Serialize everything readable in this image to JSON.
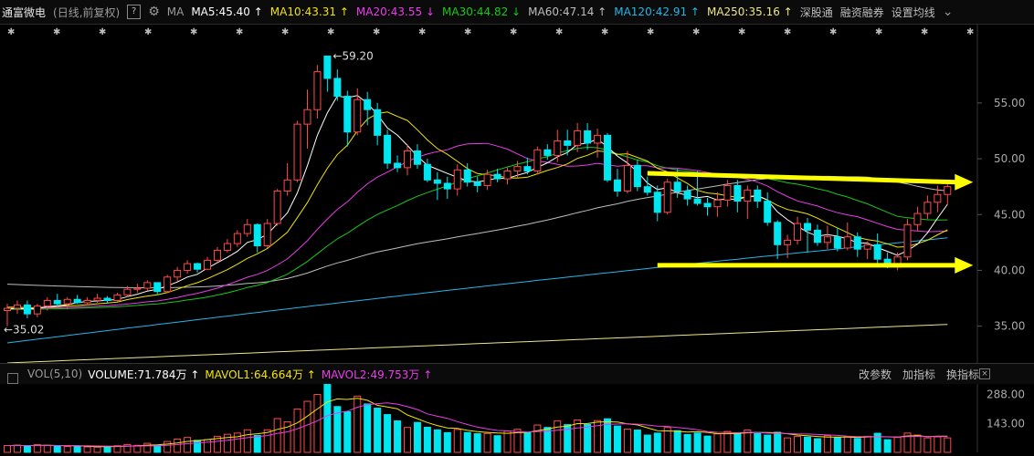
{
  "header": {
    "title": "通富微电",
    "subtitle": "(日线,前复权)",
    "help": "?",
    "ma_label": "MA",
    "ma_items": [
      {
        "text": "MA5:45.40 ↑",
        "color": "#ffffff"
      },
      {
        "text": "MA10:43.31 ↑",
        "color": "#f2e400"
      },
      {
        "text": "MA20:43.55 ↓",
        "color": "#e93de9"
      },
      {
        "text": "MA30:44.82 ↓",
        "color": "#18c818"
      },
      {
        "text": "MA60:47.14 ↑",
        "color": "#bdbdbd"
      },
      {
        "text": "MA120:42.91 ↑",
        "color": "#23b6e8"
      },
      {
        "text": "MA250:35.16 ↑",
        "color": "#efe58a"
      }
    ],
    "btn_shen": "深股通",
    "btn_rong": "融资融券",
    "btn_set": "设置均线"
  },
  "volume_header": {
    "label": "VOL(5,10)",
    "volume": "VOLUME:71.784万 ↑",
    "mavol1": "MAVOL1:64.664万 ↑",
    "mavol2": "MAVOL2:49.753万 ↑",
    "btn_params": "改参数",
    "btn_add": "加指标",
    "btn_switch": "换指标"
  },
  "colors": {
    "up": "#ff4a4a",
    "down": "#00e6f0",
    "annot": "#ffff00"
  },
  "chart_data": {
    "type": "candlestick",
    "price_axis": {
      "ticks": [
        35,
        40,
        45,
        50,
        55
      ],
      "ylim": [
        31.7,
        62.1
      ]
    },
    "volume_axis": {
      "ticks": [
        143,
        288
      ],
      "unit": "万",
      "ylim": [
        0,
        345
      ]
    },
    "annotations": {
      "high": "59.20",
      "low": "35.02"
    },
    "candles": [
      [
        36.4,
        37.0,
        35.0,
        36.6
      ],
      [
        36.6,
        37.3,
        36.1,
        36.9
      ],
      [
        36.9,
        37.3,
        35.7,
        36.1
      ],
      [
        36.1,
        37.0,
        35.8,
        36.8
      ],
      [
        36.8,
        37.6,
        36.4,
        37.3
      ],
      [
        37.3,
        37.9,
        36.8,
        37.0
      ],
      [
        37.0,
        37.6,
        36.5,
        37.4
      ],
      [
        37.4,
        37.8,
        37.0,
        37.1
      ],
      [
        37.1,
        37.6,
        36.9,
        37.3
      ],
      [
        37.3,
        37.9,
        37.1,
        37.5
      ],
      [
        37.5,
        37.7,
        37.0,
        37.3
      ],
      [
        37.3,
        38.0,
        37.2,
        37.8
      ],
      [
        37.8,
        38.6,
        37.6,
        38.3
      ],
      [
        38.3,
        38.8,
        38.0,
        38.4
      ],
      [
        38.4,
        39.1,
        38.2,
        38.9
      ],
      [
        38.9,
        38.9,
        37.8,
        38.1
      ],
      [
        38.1,
        39.6,
        38.0,
        39.4
      ],
      [
        39.4,
        40.3,
        39.0,
        40.0
      ],
      [
        40.0,
        40.9,
        39.7,
        40.6
      ],
      [
        40.6,
        40.7,
        39.8,
        40.1
      ],
      [
        40.1,
        41.2,
        40.0,
        40.9
      ],
      [
        40.9,
        42.1,
        40.6,
        41.8
      ],
      [
        41.8,
        42.8,
        41.6,
        42.4
      ],
      [
        42.4,
        43.6,
        42.1,
        43.3
      ],
      [
        43.3,
        44.6,
        43.0,
        44.1
      ],
      [
        44.1,
        44.2,
        41.6,
        42.2
      ],
      [
        42.2,
        44.6,
        42.0,
        44.2
      ],
      [
        44.2,
        47.3,
        44.0,
        47.1
      ],
      [
        47.1,
        49.6,
        46.7,
        48.1
      ],
      [
        48.1,
        53.4,
        47.9,
        53.1
      ],
      [
        53.1,
        56.2,
        50.9,
        54.4
      ],
      [
        54.4,
        58.4,
        53.6,
        57.8
      ],
      [
        59.2,
        59.2,
        56.0,
        57.2
      ],
      [
        57.2,
        58.0,
        55.2,
        55.6
      ],
      [
        55.6,
        56.1,
        51.1,
        52.4
      ],
      [
        52.4,
        56.3,
        52.1,
        55.3
      ],
      [
        55.3,
        56.0,
        53.0,
        54.4
      ],
      [
        54.4,
        55.0,
        51.2,
        52.1
      ],
      [
        52.1,
        52.6,
        49.1,
        49.6
      ],
      [
        49.6,
        50.3,
        48.8,
        49.2
      ],
      [
        49.2,
        51.3,
        48.5,
        50.7
      ],
      [
        50.7,
        51.3,
        49.1,
        49.5
      ],
      [
        49.5,
        50.0,
        47.9,
        48.1
      ],
      [
        48.1,
        48.8,
        46.3,
        47.8
      ],
      [
        47.8,
        48.4,
        46.4,
        47.3
      ],
      [
        47.3,
        49.5,
        46.7,
        49.0
      ],
      [
        49.0,
        49.6,
        47.5,
        47.9
      ],
      [
        47.9,
        48.4,
        47.0,
        47.6
      ],
      [
        47.6,
        49.0,
        47.2,
        48.6
      ],
      [
        48.6,
        49.1,
        47.9,
        48.2
      ],
      [
        48.2,
        49.2,
        47.7,
        48.9
      ],
      [
        48.9,
        49.8,
        48.3,
        49.3
      ],
      [
        49.3,
        50.1,
        48.6,
        48.9
      ],
      [
        48.9,
        51.1,
        48.6,
        50.8
      ],
      [
        50.8,
        51.3,
        49.9,
        50.3
      ],
      [
        50.3,
        52.6,
        49.7,
        51.6
      ],
      [
        51.6,
        52.6,
        50.3,
        51.2
      ],
      [
        51.2,
        53.2,
        50.6,
        52.5
      ],
      [
        52.5,
        53.2,
        50.8,
        51.4
      ],
      [
        51.4,
        52.7,
        50.1,
        52.1
      ],
      [
        52.1,
        52.3,
        47.9,
        48.1
      ],
      [
        48.1,
        49.1,
        46.6,
        47.1
      ],
      [
        47.1,
        50.7,
        46.9,
        49.4
      ],
      [
        49.4,
        49.9,
        47.1,
        47.5
      ],
      [
        47.5,
        48.4,
        46.7,
        47.0
      ],
      [
        47.0,
        47.6,
        44.4,
        45.2
      ],
      [
        45.2,
        48.2,
        45.0,
        47.9
      ],
      [
        47.9,
        49.1,
        46.5,
        47.1
      ],
      [
        47.1,
        47.6,
        45.8,
        46.4
      ],
      [
        46.4,
        48.9,
        45.8,
        46.0
      ],
      [
        46.0,
        46.5,
        44.9,
        45.7
      ],
      [
        45.7,
        47.0,
        44.8,
        46.3
      ],
      [
        46.3,
        48.1,
        45.7,
        47.6
      ],
      [
        47.6,
        48.1,
        45.2,
        46.2
      ],
      [
        46.2,
        47.6,
        44.6,
        47.2
      ],
      [
        47.2,
        47.6,
        45.6,
        46.2
      ],
      [
        46.2,
        47.0,
        44.0,
        44.3
      ],
      [
        44.3,
        44.5,
        41.0,
        42.3
      ],
      [
        42.3,
        43.2,
        41.1,
        42.7
      ],
      [
        42.7,
        44.8,
        42.3,
        44.2
      ],
      [
        44.2,
        44.7,
        41.6,
        43.6
      ],
      [
        43.6,
        44.1,
        42.2,
        42.5
      ],
      [
        42.5,
        44.0,
        41.9,
        43.0
      ],
      [
        43.0,
        43.8,
        41.7,
        42.0
      ],
      [
        42.0,
        44.3,
        41.8,
        43.0
      ],
      [
        43.0,
        43.4,
        41.2,
        41.9
      ],
      [
        41.9,
        42.6,
        41.0,
        42.3
      ],
      [
        42.3,
        43.3,
        40.5,
        41.0
      ],
      [
        41.0,
        41.6,
        40.2,
        40.3
      ],
      [
        40.3,
        41.6,
        40.0,
        41.2
      ],
      [
        41.2,
        44.6,
        40.9,
        44.1
      ],
      [
        44.1,
        45.7,
        43.5,
        45.1
      ],
      [
        45.1,
        46.7,
        44.6,
        46.1
      ],
      [
        46.1,
        47.6,
        45.2,
        46.8
      ],
      [
        46.8,
        47.7,
        45.9,
        47.5
      ]
    ],
    "volumes": [
      34,
      36,
      31,
      38,
      35,
      30,
      29,
      31,
      27,
      26,
      28,
      33,
      39,
      35,
      45,
      34,
      54,
      66,
      74,
      60,
      63,
      80,
      90,
      96,
      112,
      84,
      112,
      168,
      152,
      216,
      254,
      288,
      345,
      228,
      202,
      280,
      241,
      220,
      188,
      157,
      124,
      149,
      125,
      112,
      98,
      114,
      99,
      93,
      94,
      83,
      106,
      115,
      99,
      136,
      124,
      156,
      138,
      161,
      139,
      158,
      167,
      131,
      116,
      111,
      86,
      96,
      124,
      108,
      89,
      96,
      81,
      92,
      104,
      98,
      111,
      93,
      86,
      100,
      72,
      80,
      76,
      68,
      83,
      74,
      78,
      69,
      80,
      95,
      63,
      74,
      96,
      86,
      72,
      77,
      72
    ],
    "mavol1_last": "64.664万",
    "mavol2_last": "49.753万"
  }
}
